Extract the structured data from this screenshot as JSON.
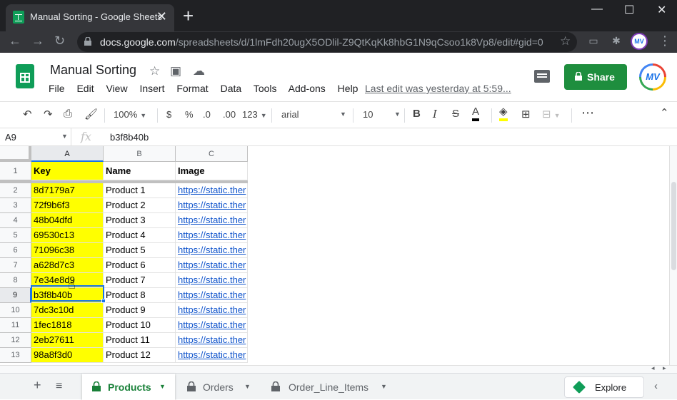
{
  "browser": {
    "tab_title": "Manual Sorting - Google Sheets",
    "url_host": "docs.google.com",
    "url_path": "/spreadsheets/d/1lmFdh20ugX5ODlil-Z9QtKqKk8hbG1N9qCsoo1k8Vp8/edit#gid=0",
    "profile_initials": "MV"
  },
  "app": {
    "doc_title": "Manual Sorting",
    "menu": [
      "File",
      "Edit",
      "View",
      "Insert",
      "Format",
      "Data",
      "Tools",
      "Add-ons",
      "Help"
    ],
    "last_edit": "Last edit was yesterday at 5:59...",
    "share_label": "Share",
    "avatar_initials": "MV"
  },
  "toolbar": {
    "zoom": "100%",
    "currency": "$",
    "percent": "%",
    "decrease_decimal": ".0",
    "increase_decimal": ".00",
    "more_formats": "123",
    "font": "arial",
    "font_size": "10"
  },
  "formula_bar": {
    "cell_ref": "A9",
    "fx": "fx",
    "value": "b3f8b40b"
  },
  "sheet": {
    "columns": [
      "A",
      "B",
      "C"
    ],
    "headers": {
      "key": "Key",
      "name": "Name",
      "image": "Image"
    },
    "rows": [
      {
        "n": "2",
        "key": "8d7179a7",
        "name": "Product 1",
        "image": "https://static.ther"
      },
      {
        "n": "3",
        "key": "72f9b6f3",
        "name": "Product 2",
        "image": "https://static.ther"
      },
      {
        "n": "4",
        "key": "48b04dfd",
        "name": "Product 3",
        "image": "https://static.ther"
      },
      {
        "n": "5",
        "key": "69530c13",
        "name": "Product 4",
        "image": "https://static.ther"
      },
      {
        "n": "6",
        "key": "71096c38",
        "name": "Product 5",
        "image": "https://static.ther"
      },
      {
        "n": "7",
        "key": "a628d7c3",
        "name": "Product 6",
        "image": "https://static.ther"
      },
      {
        "n": "8",
        "key": "7e34e8d9",
        "name": "Product 7",
        "image": "https://static.ther"
      },
      {
        "n": "9",
        "key": "b3f8b40b",
        "name": "Product 8",
        "image": "https://static.ther"
      },
      {
        "n": "10",
        "key": "7dc3c10d",
        "name": "Product 9",
        "image": "https://static.ther"
      },
      {
        "n": "11",
        "key": "1fec1818",
        "name": "Product 10",
        "image": "https://static.ther"
      },
      {
        "n": "12",
        "key": "2eb27611",
        "name": "Product 11",
        "image": "https://static.ther"
      },
      {
        "n": "13",
        "key": "98a8f3d0",
        "name": "Product 12",
        "image": "https://static.ther"
      }
    ],
    "header_row_num": "1",
    "selected_cell": "A9",
    "key_fill_color": "#ffff00",
    "link_color": "#1155cc"
  },
  "sheet_tabs": {
    "tabs": [
      "Products",
      "Orders",
      "Order_Line_Items"
    ],
    "active": "Products",
    "explore_label": "Explore"
  },
  "colors": {
    "accent": "#1a73e8",
    "share_green": "#1e8e3e",
    "sheets_green": "#0f9d58"
  }
}
